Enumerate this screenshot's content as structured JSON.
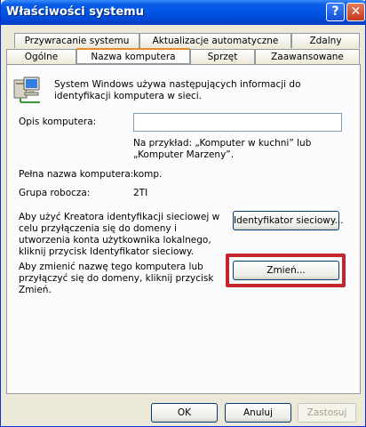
{
  "window": {
    "title": "Właściwości systemu",
    "help_glyph": "?",
    "close_glyph": "✕"
  },
  "tabs": {
    "row1": [
      "Przywracanie systemu",
      "Aktualizacje automatyczne",
      "Zdalny"
    ],
    "row2": [
      "Ogólne",
      "Nazwa komputera",
      "Sprzęt",
      "Zaawansowane"
    ],
    "active": "Nazwa komputera"
  },
  "computer_name": {
    "intro": "System Windows używa następujących informacji do identyfikacji komputera w sieci.",
    "description_label": "Opis komputera:",
    "description_value": "",
    "example": "Na przykład: „Komputer w kuchni” lub „Komputer Marzeny”.",
    "full_name_label": "Pełna nazwa komputera:",
    "full_name_value": "komp.",
    "workgroup_label": "Grupa robocza:",
    "workgroup_value": "2TI",
    "network_id_text": "Aby użyć Kreatora identyfikacji sieciowej w celu przyłączenia się do domeny i utworzenia konta użytkownika lokalnego, kliknij przycisk Identyfikator sieciowy.",
    "network_id_button": "Identyfikator sieciowy...",
    "change_text": "Aby zmienić nazwę tego komputera lub przyłączyć się do domeny, kliknij przycisk Zmień.",
    "change_button": "Zmień..."
  },
  "footer": {
    "ok": "OK",
    "cancel": "Anuluj",
    "apply": "Zastosuj",
    "apply_enabled": false
  },
  "colors": {
    "highlight": "#c3272b",
    "titlebar": "#0055e5",
    "dialog_bg": "#ece9d8"
  }
}
